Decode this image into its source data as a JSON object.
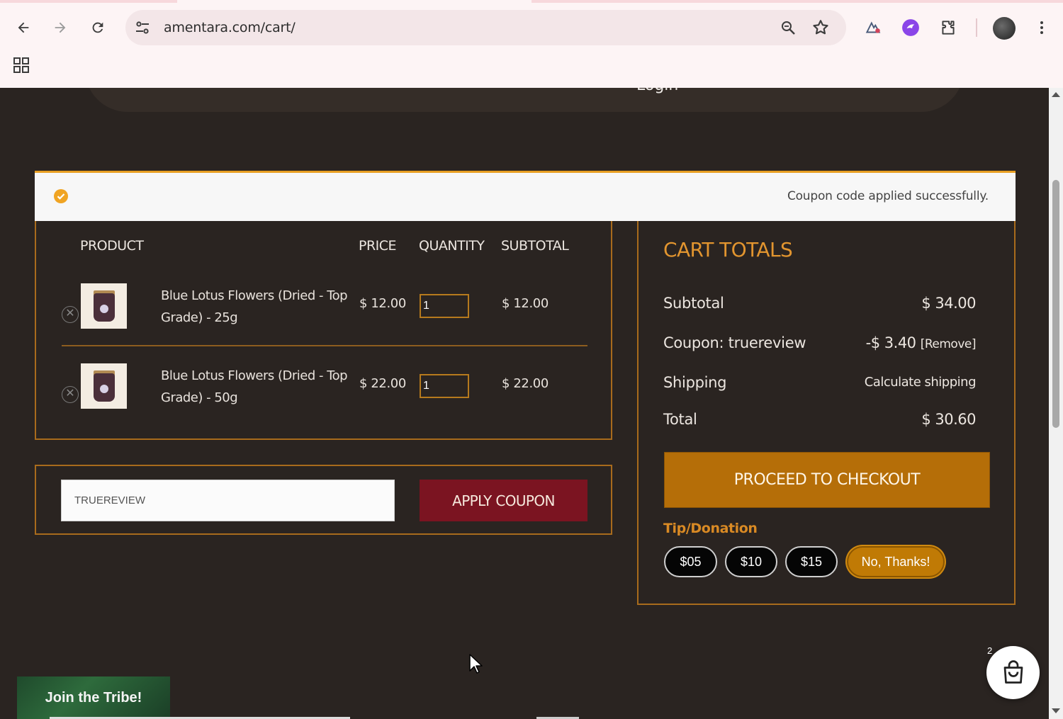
{
  "browser": {
    "url": "amentara.com/cart/",
    "icons": [
      "back-arrow-icon",
      "forward-arrow-icon",
      "reload-icon",
      "site-settings-icon",
      "zoom-icon",
      "bookmark-star-icon",
      "extension-icon",
      "extension-icon",
      "puzzle-icon",
      "profile-avatar",
      "more-vert-icon",
      "apps-grid-icon"
    ]
  },
  "header": {
    "login_label": "Login"
  },
  "notice": {
    "message": "Coupon code applied successfully."
  },
  "cart": {
    "columns": [
      "PRODUCT",
      "PRICE",
      "QUANTITY",
      "SUBTOTAL"
    ],
    "items": [
      {
        "name": "Blue Lotus Flowers (Dried - Top Grade) - 25g",
        "price": "$ 12.00",
        "quantity": "1",
        "subtotal": "$ 12.00"
      },
      {
        "name": "Blue Lotus Flowers (Dried - Top Grade) - 50g",
        "price": "$ 22.00",
        "quantity": "1",
        "subtotal": "$ 22.00"
      }
    ]
  },
  "coupon": {
    "value": "TRUEREVIEW",
    "apply_label": "APPLY COUPON"
  },
  "totals": {
    "title": "CART TOTALS",
    "subtotal_label": "Subtotal",
    "subtotal_value": "$ 34.00",
    "coupon_label": "Coupon: truereview",
    "coupon_value": "-$ 3.40",
    "coupon_remove": "[Remove]",
    "shipping_label": "Shipping",
    "shipping_value": "Calculate shipping",
    "total_label": "Total",
    "total_value": "$ 30.60",
    "checkout_label": "PROCEED TO CHECKOUT",
    "tip_title": "Tip/Donation",
    "tips": [
      "$05",
      "$10",
      "$15",
      "No, Thanks!"
    ],
    "tip_selected": "No, Thanks!"
  },
  "footer": {
    "tribe_label": "Join the Tribe!",
    "cart_count": "2"
  },
  "colors": {
    "page_bg": "#2a2421",
    "accent": "#e2952f",
    "border": "#a86b1c",
    "apply_button": "#7b1421",
    "checkout_button": "#b56e08"
  }
}
